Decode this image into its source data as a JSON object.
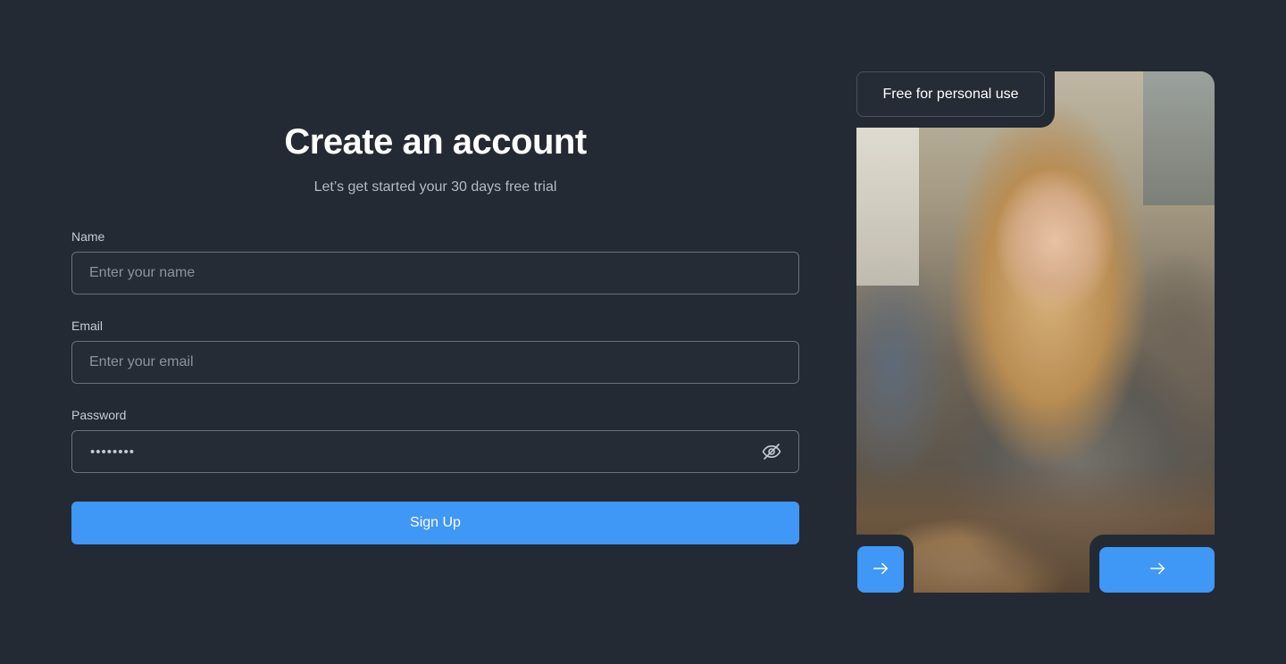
{
  "form": {
    "title": "Create an account",
    "subtitle": "Let’s get started your 30 days free trial",
    "name_label": "Name",
    "name_placeholder": "Enter your name",
    "email_label": "Email",
    "email_placeholder": "Enter your email",
    "password_label": "Password",
    "password_value": "••••••••",
    "password_toggle_icon": "eye-off-icon",
    "submit_label": "Sign Up"
  },
  "showcase": {
    "badge": "Free for personal use",
    "photo_icon": "student-photo",
    "prev_icon": "arrow-right-icon",
    "next_icon": "arrow-right-icon"
  },
  "colors": {
    "background": "#242a33",
    "accent": "#3f97f6",
    "input_border": "#6a717c"
  }
}
